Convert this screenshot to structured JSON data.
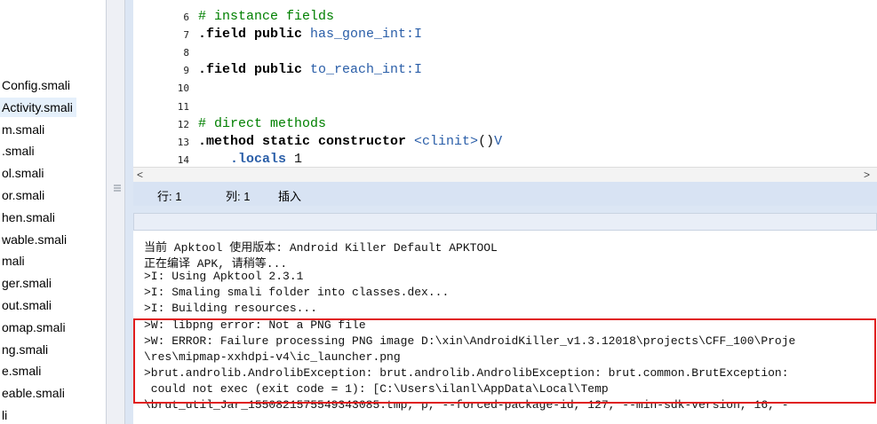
{
  "file_list": {
    "items": [
      {
        "label": "Config.smali",
        "selected": false
      },
      {
        "label": "Activity.smali",
        "selected": true
      },
      {
        "label": "m.smali",
        "selected": false
      },
      {
        "label": ".smali",
        "selected": false
      },
      {
        "label": "ol.smali",
        "selected": false
      },
      {
        "label": "or.smali",
        "selected": false
      },
      {
        "label": "hen.smali",
        "selected": false
      },
      {
        "label": "wable.smali",
        "selected": false
      },
      {
        "label": "mali",
        "selected": false
      },
      {
        "label": "ger.smali",
        "selected": false
      },
      {
        "label": "out.smali",
        "selected": false
      },
      {
        "label": "omap.smali",
        "selected": false
      },
      {
        "label": "ng.smali",
        "selected": false
      },
      {
        "label": "e.smali",
        "selected": false
      },
      {
        "label": "eable.smali",
        "selected": false
      },
      {
        "label": "li",
        "selected": false
      }
    ]
  },
  "editor": {
    "lines": [
      {
        "n": "6",
        "parts": [
          [
            "cm",
            "# instance fields"
          ]
        ]
      },
      {
        "n": "7",
        "parts": [
          [
            "kw",
            ".field public "
          ],
          [
            "id",
            "has_gone_int:I"
          ]
        ]
      },
      {
        "n": "8",
        "parts": []
      },
      {
        "n": "9",
        "parts": [
          [
            "kw",
            ".field public "
          ],
          [
            "id",
            "to_reach_int:I"
          ]
        ]
      },
      {
        "n": "10",
        "parts": []
      },
      {
        "n": "11",
        "parts": []
      },
      {
        "n": "12",
        "parts": [
          [
            "cm",
            "# direct methods"
          ]
        ]
      },
      {
        "n": "13",
        "parts": [
          [
            "kw",
            ".method static constructor "
          ],
          [
            "id",
            "<clinit>"
          ],
          [
            "plain",
            "()"
          ],
          [
            "id",
            "V"
          ]
        ]
      },
      {
        "n": "14",
        "parts": [
          [
            "plain",
            "    "
          ],
          [
            "dir",
            ".locals "
          ],
          [
            "plain",
            "1"
          ]
        ]
      }
    ],
    "hscroll_left": "<",
    "hscroll_right": ">"
  },
  "status": {
    "row_label": "行: 1",
    "col_label": "列: 1",
    "mode": "插入"
  },
  "console": {
    "lines": [
      "当前 Apktool 使用版本: Android Killer Default APKTOOL",
      "正在编译 APK, 请稍等...",
      ">I: Using Apktool 2.3.1",
      ">I: Smaling smali folder into classes.dex...",
      ">I: Building resources...",
      ">W: libpng error: Not a PNG file",
      ">W: ERROR: Failure processing PNG image D:\\xin\\AndroidKiller_v1.3.12018\\projects\\CFF_100\\Proje",
      "\\res\\mipmap-xxhdpi-v4\\ic_launcher.png",
      ">brut.androlib.AndrolibException: brut.androlib.AndrolibException: brut.common.BrutException:",
      " could not exec (exit code = 1): [C:\\Users\\ilanl\\AppData\\Local\\Temp",
      "\\brut_util_Jar_1550821575549343085.tmp, p, --forced-package-id, 127, --min-sdk-version, 16, -"
    ]
  },
  "colors": {
    "highlight_border": "#e01e1e",
    "panel_bg": "#dce6f4",
    "selection_bg": "#e5f0fb"
  }
}
